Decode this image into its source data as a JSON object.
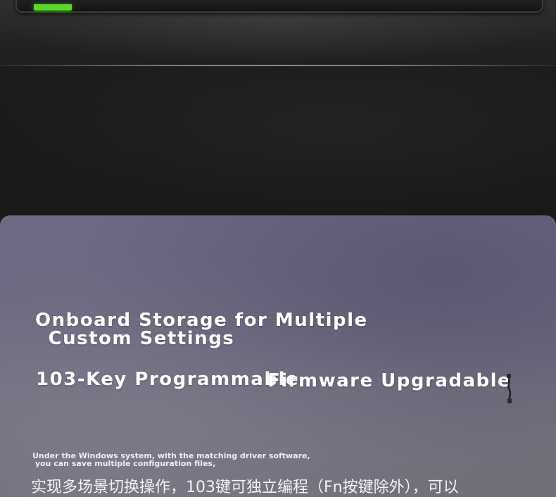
{
  "features": {
    "storage_line1": "Onboard Storage for Multiple",
    "storage_line2": " Custom Settings",
    "keys": "103-Key Programmable",
    "firmware": "Firmware Upgradable"
  },
  "description": {
    "line1": "Under the Windows system, with the matching driver software,",
    "line2": " you can save multiple configuration files,",
    "chinese": "实现多场景切换操作，103键可独立编程（Fn按键除外），可以"
  },
  "icons": {
    "indicator": "green-indicator",
    "dot": "dot-icon",
    "cable": "cable-icon"
  },
  "colors": {
    "indicator": "#5bd62a",
    "panel": "#6e6c82",
    "background": "#1a1a1b",
    "text": "#ffffff"
  }
}
